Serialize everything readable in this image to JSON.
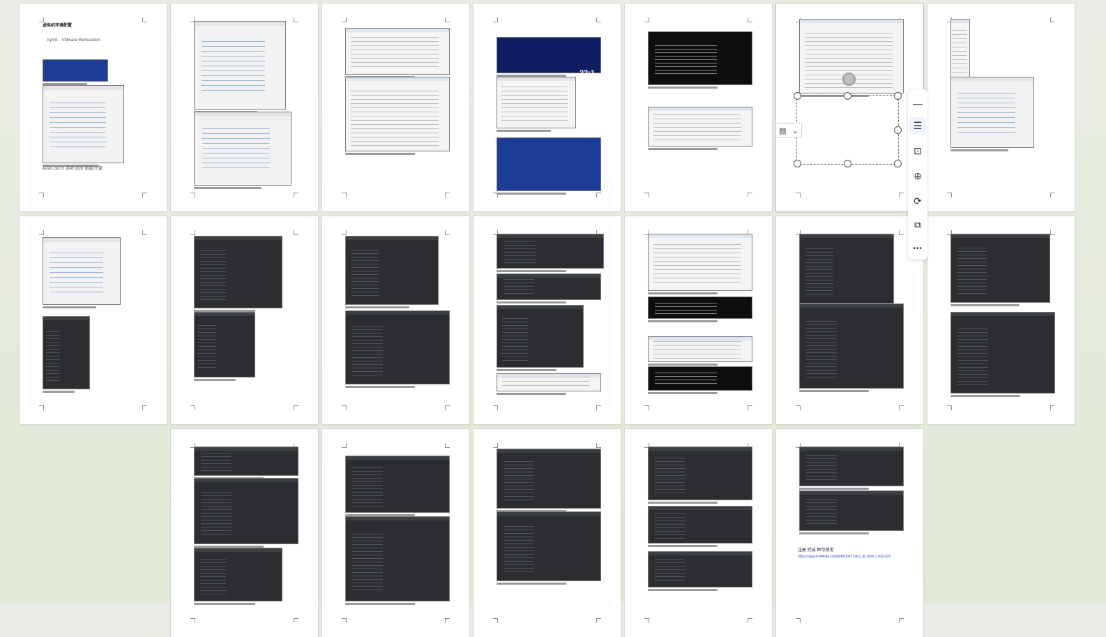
{
  "document_view": {
    "pages_row1": 7,
    "pages_row2": 7,
    "pages_row3": 5,
    "page1_title": "虚拟机环境配置",
    "page1_window_title": "kylin1 - VMware Workstation",
    "page1_caption": "启动1.BIOS 选项 选择 磁盘/光盘",
    "page22_url": "https://space-bt4b4a.com/bd82/0477/pro_id_from-1.022-022",
    "page22_caption": "注册 完成 即可使用",
    "page_clock": "22:1"
  },
  "floating_toolbar": {
    "tools": [
      {
        "name": "minus-icon",
        "glyph": "—"
      },
      {
        "name": "text-wrap-icon",
        "glyph": "☰"
      },
      {
        "name": "crop-icon",
        "glyph": "⊡"
      },
      {
        "name": "zoom-in-icon",
        "glyph": "⊕"
      },
      {
        "name": "rotate-icon",
        "glyph": "⟳"
      },
      {
        "name": "copy-icon",
        "glyph": "⧉"
      },
      {
        "name": "more-icon",
        "glyph": "•••"
      }
    ]
  },
  "layout_button": {
    "glyph": "▤",
    "chevron": "⌄"
  }
}
